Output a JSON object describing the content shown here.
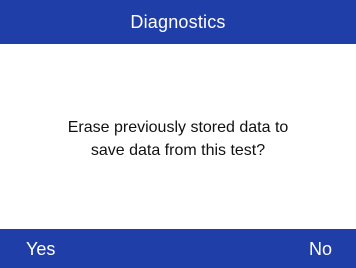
{
  "header": {
    "title": "Diagnostics"
  },
  "dialog": {
    "message": "Erase previously stored data to save data from this test?"
  },
  "softkeys": {
    "left_label": "Yes",
    "right_label": "No"
  },
  "colors": {
    "bar_background": "#1f3ea8",
    "bar_text": "#ffffff",
    "body_background": "#ffffff",
    "body_text": "#111111"
  }
}
